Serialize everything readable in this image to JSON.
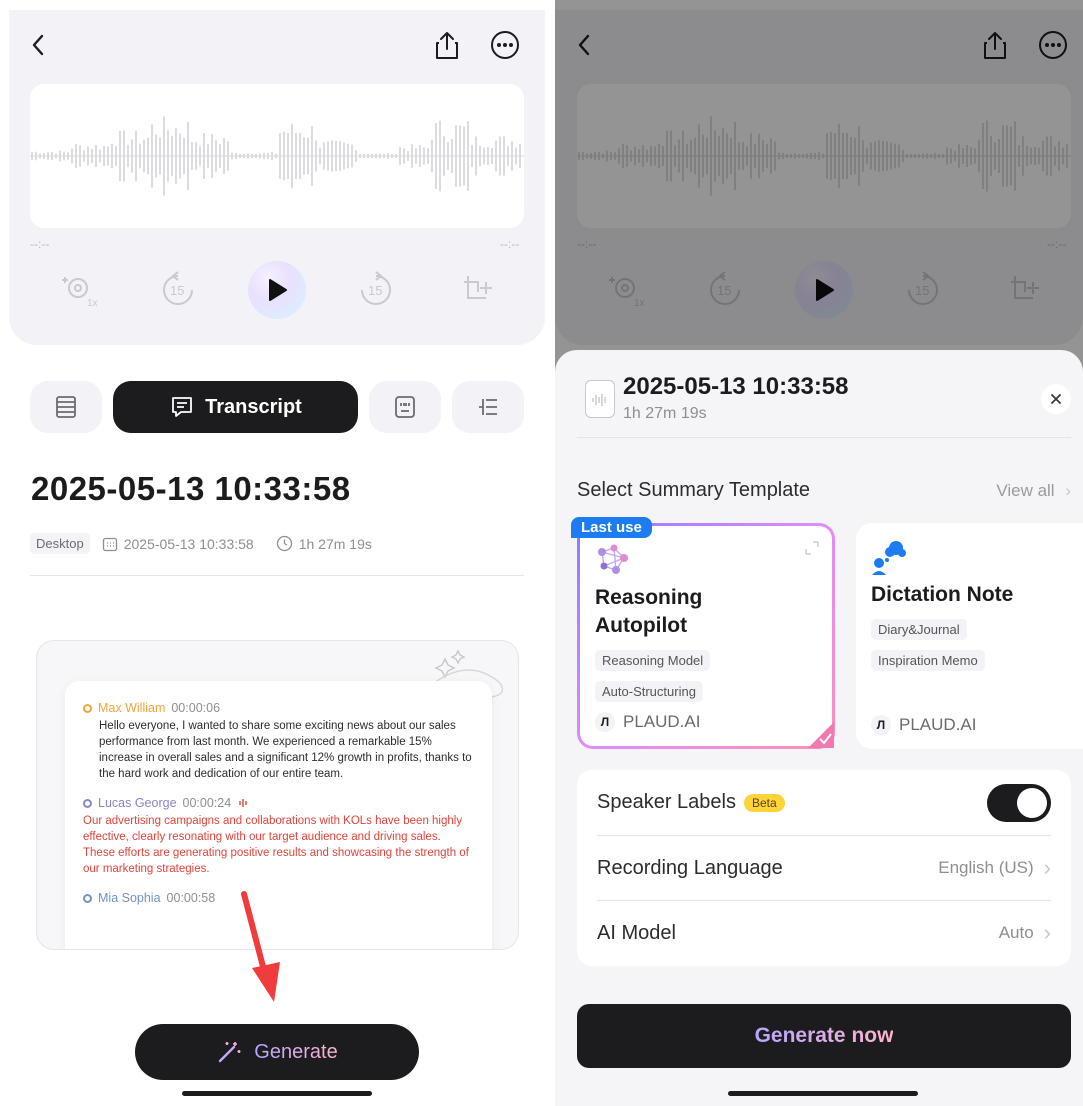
{
  "player": {
    "time_start": "--:--",
    "time_end": "--:--",
    "speed_badge": "1x",
    "skip_back": "15",
    "skip_forward": "15"
  },
  "tabs": {
    "active_label": "Transcript"
  },
  "recording": {
    "title": "2025-05-13 10:33:58",
    "source": "Desktop",
    "datetime": "2025-05-13 10:33:58",
    "duration": "1h 27m 19s"
  },
  "transcript_preview": [
    {
      "speaker": "Max William",
      "time": "00:00:06",
      "color": "#f0a43a",
      "text": "Hello everyone, I wanted to share some exciting news about our sales performance from last month. We experienced a remarkable 15% increase in overall sales and a significant 12% growth in profits, thanks to the hard work and dedication of our entire team."
    },
    {
      "speaker": "Lucas George",
      "time": "00:00:24",
      "color": "#8a86c4",
      "text": "Our advertising campaigns and collaborations with KOLs have been highly effective, clearly resonating with our target audience and driving sales. These efforts are generating positive results and showcasing the strength of our marketing strategies."
    },
    {
      "speaker": "Mia Sophia",
      "time": "00:00:58",
      "color": "#6f93c4",
      "text": ""
    }
  ],
  "generate_button": {
    "label": "Generate"
  },
  "sheet": {
    "title": "2025-05-13 10:33:58",
    "duration": "1h 27m 19s",
    "section_title": "Select Summary Template",
    "view_all": "View all",
    "templates": [
      {
        "badge": "Last use",
        "name_line1": "Reasoning",
        "name_line2": "Autopilot",
        "tags": [
          "Reasoning Model",
          "Auto-Structuring"
        ],
        "brand": "PLAUD.AI",
        "selected": true
      },
      {
        "badge": "",
        "name_line1": "Dictation Note",
        "name_line2": "",
        "tags": [
          "Diary&Journal",
          "Inspiration Memo"
        ],
        "brand": "PLAUD.AI",
        "selected": false
      }
    ],
    "settings": {
      "speaker_labels": "Speaker Labels",
      "beta": "Beta",
      "speaker_labels_on": true,
      "recording_language": "Recording Language",
      "recording_language_value": "English (US)",
      "ai_model": "AI Model",
      "ai_model_value": "Auto"
    },
    "generate_now": "Generate now"
  },
  "colors": {
    "dark": "#1c1c1e",
    "accent_blue": "#1d7cf2",
    "beta_yellow": "#ffd43b",
    "arrow_red": "#f03c3c",
    "speaker_2_text": "#e0443c"
  },
  "icons": [
    "back-icon",
    "share-icon",
    "more-icon",
    "speed-icon",
    "rewind-15-icon",
    "play-icon",
    "forward-15-icon",
    "clip-icon",
    "outline-icon",
    "chat-icon",
    "quote-icon",
    "list-indent-icon",
    "calendar-icon",
    "clock-icon",
    "magic-wand-icon",
    "file-audio-icon",
    "close-icon",
    "chevron-right-icon",
    "sparkle-icon"
  ]
}
